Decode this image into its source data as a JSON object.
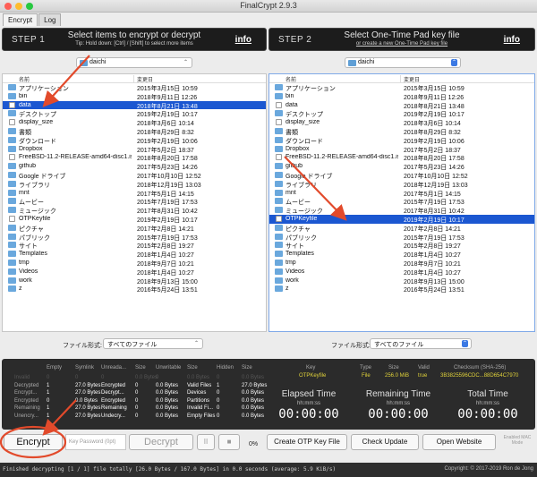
{
  "window": {
    "title": "FinalCrypt 2.9.3"
  },
  "tabs": [
    {
      "label": "Encrypt"
    },
    {
      "label": "Log"
    }
  ],
  "step1": {
    "step": "STEP 1",
    "heading": "Select items to encrypt or decrypt",
    "tip": "Tip: Hold down: [Ctrl] / [Shift] to select more items",
    "info": "info"
  },
  "step2": {
    "step": "STEP 2",
    "heading": "Select One-Time Pad key file",
    "sub": "or create a new One-Time Pad key file",
    "info": "info"
  },
  "left_folder": "daichi",
  "right_folder": "daichi",
  "columns": {
    "name": "名前",
    "date": "変更日"
  },
  "left_files": [
    {
      "name": "アプリケーション",
      "date": "2015年3月15日 10:59",
      "type": "folder"
    },
    {
      "name": "bin",
      "date": "2018年9月11日 12:26",
      "type": "folder"
    },
    {
      "name": "data",
      "date": "2018年8月21日 13:48",
      "type": "file",
      "selected": true
    },
    {
      "name": "デスクトップ",
      "date": "2019年2月19日 10:17",
      "type": "folder"
    },
    {
      "name": "display_size",
      "date": "2018年3月6日 10:14",
      "type": "file"
    },
    {
      "name": "書類",
      "date": "2018年8月29日 8:32",
      "type": "folder"
    },
    {
      "name": "ダウンロード",
      "date": "2019年2月19日 10:06",
      "type": "folder"
    },
    {
      "name": "Dropbox",
      "date": "2017年5月2日 18:37",
      "type": "folder"
    },
    {
      "name": "FreeBSD-11.2-RELEASE-amd64-disc1.iso",
      "date": "2018年8月20日 17:58",
      "type": "file"
    },
    {
      "name": "github",
      "date": "2017年5月23日 14:26",
      "type": "folder"
    },
    {
      "name": "Google ドライブ",
      "date": "2017年10月10日 12:52",
      "type": "folder"
    },
    {
      "name": "ライブラリ",
      "date": "2018年12月19日 13:03",
      "type": "folder"
    },
    {
      "name": "mnt",
      "date": "2017年5月1日 14:15",
      "type": "folder"
    },
    {
      "name": "ムービー",
      "date": "2015年7月19日 17:53",
      "type": "folder"
    },
    {
      "name": "ミュージック",
      "date": "2017年8月31日 10:42",
      "type": "folder"
    },
    {
      "name": "OTPKeyfile",
      "date": "2019年2月19日 10:17",
      "type": "file"
    },
    {
      "name": "ピクチャ",
      "date": "2017年2月8日 14:21",
      "type": "folder"
    },
    {
      "name": "パブリック",
      "date": "2015年7月19日 17:53",
      "type": "folder"
    },
    {
      "name": "サイト",
      "date": "2015年2月8日 19:27",
      "type": "folder"
    },
    {
      "name": "Templates",
      "date": "2018年1月4日 10:27",
      "type": "folder"
    },
    {
      "name": "tmp",
      "date": "2018年9月7日 10:21",
      "type": "folder"
    },
    {
      "name": "Videos",
      "date": "2018年1月4日 10:27",
      "type": "folder"
    },
    {
      "name": "work",
      "date": "2018年9月13日 15:00",
      "type": "folder"
    },
    {
      "name": "z",
      "date": "2016年5月24日 13:51",
      "type": "folder"
    }
  ],
  "right_files": [
    {
      "name": "アプリケーション",
      "date": "2015年3月15日 10:59",
      "type": "folder"
    },
    {
      "name": "bin",
      "date": "2018年9月11日 12:26",
      "type": "folder"
    },
    {
      "name": "data",
      "date": "2018年8月21日 13:48",
      "type": "file"
    },
    {
      "name": "デスクトップ",
      "date": "2019年2月19日 10:17",
      "type": "folder"
    },
    {
      "name": "display_size",
      "date": "2018年3月6日 10:14",
      "type": "file"
    },
    {
      "name": "書類",
      "date": "2018年8月29日 8:32",
      "type": "folder"
    },
    {
      "name": "ダウンロード",
      "date": "2019年2月19日 10:06",
      "type": "folder"
    },
    {
      "name": "Dropbox",
      "date": "2017年5月2日 18:37",
      "type": "folder"
    },
    {
      "name": "FreeBSD-11.2-RELEASE-amd64-disc1.iso",
      "date": "2018年8月20日 17:58",
      "type": "file"
    },
    {
      "name": "github",
      "date": "2017年5月23日 14:26",
      "type": "folder"
    },
    {
      "name": "Google ドライブ",
      "date": "2017年10月10日 12:52",
      "type": "folder"
    },
    {
      "name": "ライブラリ",
      "date": "2018年12月19日 13:03",
      "type": "folder"
    },
    {
      "name": "mnt",
      "date": "2017年5月1日 14:15",
      "type": "folder"
    },
    {
      "name": "ムービー",
      "date": "2015年7月19日 17:53",
      "type": "folder"
    },
    {
      "name": "ミュージック",
      "date": "2017年8月31日 10:42",
      "type": "folder"
    },
    {
      "name": "OTPKeyfile",
      "date": "2019年2月19日 10:17",
      "type": "file",
      "selected": true
    },
    {
      "name": "ピクチャ",
      "date": "2017年2月8日 14:21",
      "type": "folder"
    },
    {
      "name": "パブリック",
      "date": "2015年7月19日 17:53",
      "type": "folder"
    },
    {
      "name": "サイト",
      "date": "2015年2月8日 19:27",
      "type": "folder"
    },
    {
      "name": "Templates",
      "date": "2018年1月4日 10:27",
      "type": "folder"
    },
    {
      "name": "tmp",
      "date": "2018年9月7日 10:21",
      "type": "folder"
    },
    {
      "name": "Videos",
      "date": "2018年1月4日 10:27",
      "type": "folder"
    },
    {
      "name": "work",
      "date": "2018年9月13日 15:00",
      "type": "folder"
    },
    {
      "name": "z",
      "date": "2016年5月24日 13:51",
      "type": "folder"
    }
  ],
  "format": {
    "label": "ファイル形式:",
    "left_value": "すべてのファイル",
    "right_value": "すべてのファイル"
  },
  "stats": {
    "headers": [
      "Empty",
      "Symlink",
      "Unreada...",
      "Size",
      "Unwritable",
      "Size",
      "Hidden",
      "Size"
    ],
    "rows": [
      {
        "label": "Invalid",
        "dim": true,
        "cells": [
          "0",
          "0",
          "0",
          "0.0 Bytes",
          "0",
          "0.0 Bytes",
          "0",
          "0.0 Bytes"
        ]
      },
      {
        "label": "Decrypted",
        "cells": [
          "1",
          "27.0 Bytes",
          "Encrypted",
          "0",
          "0.0 Bytes",
          "Valid Files",
          "1",
          "27.0 Bytes"
        ]
      },
      {
        "label": "Encrypt...",
        "cells": [
          "1",
          "27.0 Bytes",
          "Decrypt...",
          "0",
          "0.0 Bytes",
          "Devices",
          "0",
          "0.0 Bytes"
        ]
      },
      {
        "label": "Encrypted",
        "cells": [
          "0",
          "0.0 Bytes",
          "Encrypted",
          "0",
          "0.0 Bytes",
          "Partitions",
          "0",
          "0.0 Bytes"
        ]
      },
      {
        "label": "Remaining",
        "cells": [
          "1",
          "27.0 Bytes",
          "Remaining",
          "0",
          "0.0 Bytes",
          "Invalid Fi...",
          "0",
          "0.0 Bytes"
        ]
      },
      {
        "label": "Unencry...",
        "cells": [
          "1",
          "27.0 Bytes",
          "Undecry...",
          "0",
          "0.0 Bytes",
          "Empty Files",
          "0",
          "0.0 Bytes"
        ]
      }
    ],
    "key": {
      "h_key": "Key",
      "h_type": "Type",
      "h_size": "Size",
      "h_valid": "Valid",
      "h_checksum": "Checksum (SHA-256)",
      "key": "OTPKeyfile",
      "type": "File",
      "size": "256.0 MiB",
      "valid": "true",
      "checksum": "3B3825596CDC...88D654C7970"
    }
  },
  "timers": [
    {
      "title": "Elapsed Time",
      "sub": "hh:mm:ss",
      "value": "00:00:00"
    },
    {
      "title": "Remaining Time",
      "sub": "hh:mm:ss",
      "value": "00:00:00"
    },
    {
      "title": "Total Time",
      "sub": "hh:mm:ss",
      "value": "00:00:00"
    }
  ],
  "bottom": {
    "encrypt": "Encrypt",
    "password_placeholder": "Key Password (0pt)",
    "decrypt": "Decrypt",
    "pause": "II",
    "stop": "■",
    "progress": "0%",
    "create_otp": "Create OTP Key File",
    "check_update": "Check Update",
    "open_website": "Open Website",
    "mac_mode": "Enabled MAC Mode"
  },
  "status": {
    "message": "Finished decrypting [1 / 1] file totally [26.0 Bytes / 167.0 Bytes] in 0.0 seconds  (average: 5.9 KiB/s)",
    "copyright": "Copyright: © 2017-2019 Ron de Jong"
  },
  "colors": {
    "selection": "#1b57d1",
    "annotation": "#e24a2b",
    "panel": "#2b2b2b",
    "folder": "#6aa8dd"
  }
}
